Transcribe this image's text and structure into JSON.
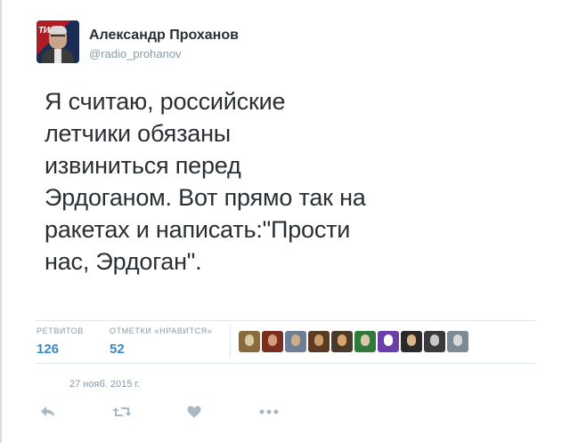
{
  "author": {
    "display_name": "Александр Проханов",
    "username": "@radio_prohanov"
  },
  "tweet": {
    "text_lines": [
      "Я считаю, российские",
      "летчики обязаны",
      "извиниться перед",
      "Эрдоганом. Вот прямо так на",
      "ракетах и написать:\"Прости",
      "нас, Эрдоган\"."
    ],
    "timestamp": "27 нояб. 2015 г."
  },
  "stats": {
    "retweets_label": "РЕТВИТОВ",
    "retweets_value": "126",
    "likes_label": "ОТМЕТКИ «НРАВИТСЯ»",
    "likes_value": "52"
  },
  "liked_by_avatars": [
    {
      "name": "user-avatar-1",
      "colors": [
        "#8a6b3d",
        "#d8c9a2"
      ]
    },
    {
      "name": "user-avatar-2",
      "colors": [
        "#7a2e1f",
        "#d79a7a"
      ]
    },
    {
      "name": "user-avatar-3",
      "colors": [
        "#6d7f95",
        "#c9b08a"
      ]
    },
    {
      "name": "user-avatar-4",
      "colors": [
        "#5b3b22",
        "#c9a06a"
      ]
    },
    {
      "name": "user-avatar-5",
      "colors": [
        "#4a3a2a",
        "#d7a36a"
      ]
    },
    {
      "name": "user-avatar-6",
      "colors": [
        "#2f7a3a",
        "#d8c8a8"
      ]
    },
    {
      "name": "user-avatar-7",
      "colors": [
        "#6a3fa8",
        "#ffffff"
      ]
    },
    {
      "name": "user-avatar-8",
      "colors": [
        "#2a2a2a",
        "#d8b48a"
      ]
    },
    {
      "name": "user-avatar-9",
      "colors": [
        "#3a3a3a",
        "#c7c7c7"
      ]
    },
    {
      "name": "user-avatar-10",
      "colors": [
        "#7b8a96",
        "#d8d8d8"
      ]
    }
  ],
  "actions": {
    "reply_icon": "reply-icon",
    "retweet_icon": "retweet-icon",
    "like_icon": "heart-icon",
    "more_icon": "more-icon"
  },
  "colors": {
    "link_blue": "#3b88c3",
    "muted": "#8899a6",
    "action_gray": "#aab8c2"
  }
}
